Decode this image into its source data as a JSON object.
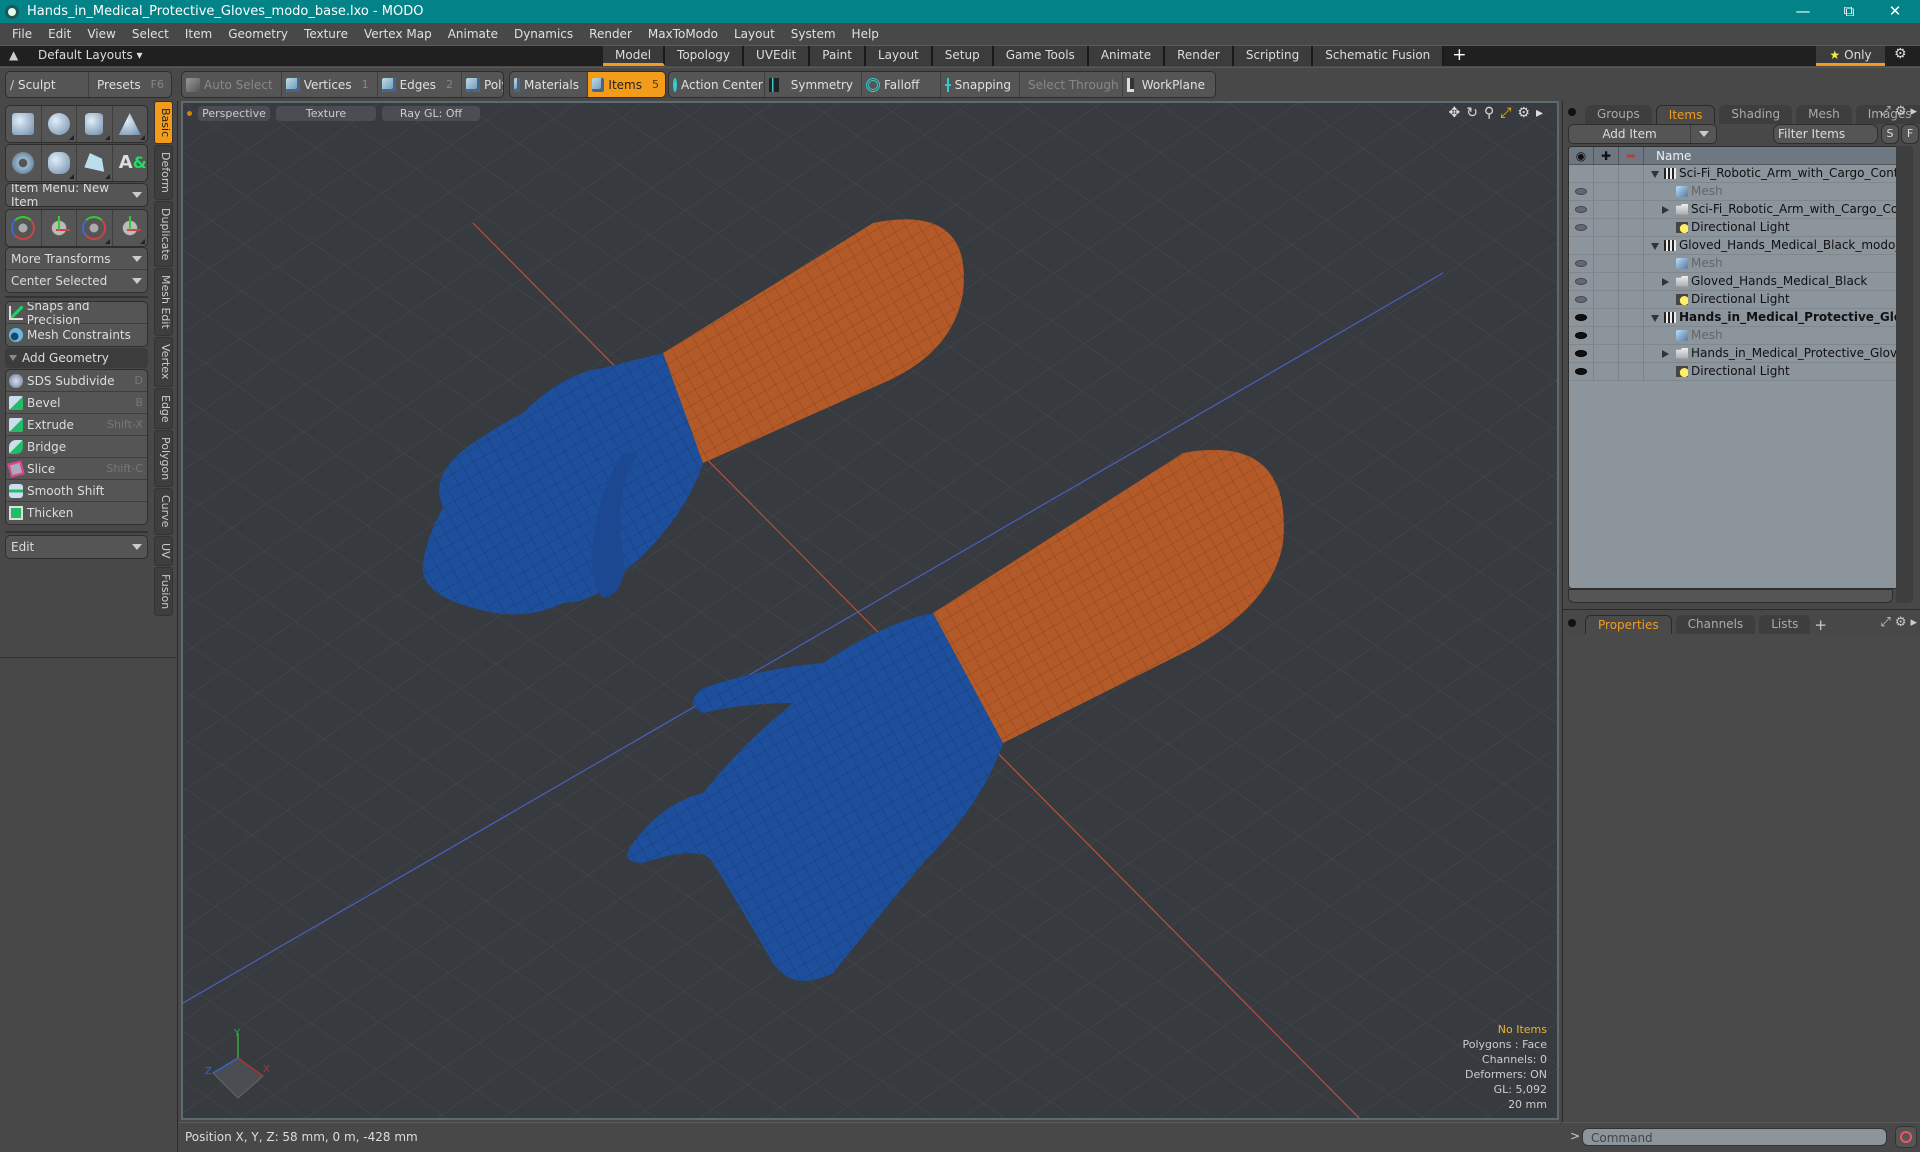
{
  "window": {
    "title": "Hands_in_Medical_Protective_Gloves_modo_base.lxo - MODO",
    "controls": [
      "minimize",
      "maximize",
      "close"
    ]
  },
  "menubar": [
    "File",
    "Edit",
    "View",
    "Select",
    "Item",
    "Geometry",
    "Texture",
    "Vertex Map",
    "Animate",
    "Dynamics",
    "Render",
    "MaxToModo",
    "Layout",
    "System",
    "Help"
  ],
  "layoutbar": {
    "layouts_label": "Default Layouts",
    "tabs": [
      "Model",
      "Topology",
      "UVEdit",
      "Paint",
      "Layout",
      "Setup",
      "Game Tools",
      "Animate",
      "Render",
      "Scripting",
      "Schematic Fusion"
    ],
    "active_tab": "Model",
    "add_tab": "+",
    "only_label": "Only"
  },
  "toolbar": {
    "sculpt": "Sculpt",
    "presets": "Presets",
    "presets_key": "F6",
    "auto_select": "Auto Select",
    "vertices": "Vertices",
    "vertices_key": "1",
    "edges": "Edges",
    "edges_key": "2",
    "polygons": "Polygons",
    "materials": "Materials",
    "items": "Items",
    "items_key": "5",
    "action_center": "Action Center",
    "symmetry": "Symmetry",
    "falloff": "Falloff",
    "snapping": "Snapping",
    "select_through": "Select Through",
    "workplane": "WorkPlane"
  },
  "leftpanel": {
    "item_menu": "Item Menu: New Item",
    "more_transforms": "More Transforms",
    "center_selected": "Center Selected",
    "snaps": "Snaps and Precision",
    "mesh_constraints": "Mesh Constraints",
    "add_geometry": "Add Geometry",
    "tools": [
      {
        "label": "SDS Subdivide",
        "key": "D"
      },
      {
        "label": "Bevel",
        "key": "B"
      },
      {
        "label": "Extrude",
        "key": "Shift-X"
      },
      {
        "label": "Bridge",
        "key": ""
      },
      {
        "label": "Slice",
        "key": "Shift-C"
      },
      {
        "label": "Smooth Shift",
        "key": ""
      },
      {
        "label": "Thicken",
        "key": ""
      }
    ],
    "edit": "Edit",
    "vtabs": [
      "Basic",
      "Deform",
      "Duplicate",
      "Mesh Edit",
      "Vertex",
      "Edge",
      "Polygon",
      "Curve",
      "UV",
      "Fusion"
    ],
    "active_vtab": "Basic"
  },
  "viewport": {
    "view": "Perspective",
    "shading": "Texture",
    "raygl": "Ray GL: Off",
    "info": {
      "selection": "No Items",
      "polygons": "Polygons : Face",
      "channels": "Channels: 0",
      "deformers": "Deformers: ON",
      "gl": "GL: 5,092",
      "scale": "20 mm"
    },
    "axes": {
      "x": "X",
      "y": "Y",
      "z": "Z"
    },
    "colors": {
      "glove": "#1e4f9c",
      "sleeve": "#b45a28",
      "background": "#373b3f"
    }
  },
  "statusbar": {
    "position": "Position X, Y, Z:   58 mm, 0 m, -428 mm"
  },
  "rightpanel": {
    "tabs": [
      "Groups",
      "Items",
      "Shading",
      "Mesh ...",
      "Images"
    ],
    "active_tab": "Items",
    "add_item": "Add Item",
    "filter": "Filter Items",
    "s_btn": "S",
    "f_btn": "F",
    "name_header": "Name",
    "items": [
      {
        "label": "Sci-Fi_Robotic_Arm_with_Cargo_Container ...",
        "type": "scene",
        "depth": 0,
        "expand": "down",
        "eye": "none",
        "style": "normal"
      },
      {
        "label": "Mesh",
        "type": "mesh",
        "depth": 1,
        "expand": "none",
        "eye": "dim",
        "style": "dim"
      },
      {
        "label": "Sci-Fi_Robotic_Arm_with_Cargo_Container",
        "type": "group",
        "depth": 1,
        "expand": "right",
        "eye": "dim",
        "style": "normal"
      },
      {
        "label": "Directional Light",
        "type": "light",
        "depth": 1,
        "expand": "none",
        "eye": "dim",
        "style": "normal"
      },
      {
        "label": "Gloved_Hands_Medical_Black_modo_base.lxo",
        "type": "scene",
        "depth": 0,
        "expand": "down",
        "eye": "none",
        "style": "normal"
      },
      {
        "label": "Mesh",
        "type": "mesh",
        "depth": 1,
        "expand": "none",
        "eye": "dim",
        "style": "dim"
      },
      {
        "label": "Gloved_Hands_Medical_Black",
        "type": "group",
        "depth": 1,
        "expand": "right",
        "eye": "dim",
        "style": "normal"
      },
      {
        "label": "Directional Light",
        "type": "light",
        "depth": 1,
        "expand": "none",
        "eye": "dim",
        "style": "normal"
      },
      {
        "label": "Hands_in_Medical_Protective_Glove...",
        "type": "scene",
        "depth": 0,
        "expand": "down",
        "eye": "on",
        "style": "bold"
      },
      {
        "label": "Mesh",
        "type": "mesh",
        "depth": 1,
        "expand": "none",
        "eye": "on",
        "style": "dim"
      },
      {
        "label": "Hands_in_Medical_Protective_Gloves",
        "type": "group",
        "depth": 1,
        "expand": "right",
        "eye": "on",
        "style": "normal"
      },
      {
        "label": "Directional Light",
        "type": "light",
        "depth": 1,
        "expand": "none",
        "eye": "on",
        "style": "normal"
      }
    ],
    "bottom_tabs": [
      "Properties",
      "Channels",
      "Lists"
    ],
    "bottom_active": "Properties"
  },
  "command": {
    "prompt": ">",
    "placeholder": "Command"
  },
  "accent": "#f39c1c"
}
